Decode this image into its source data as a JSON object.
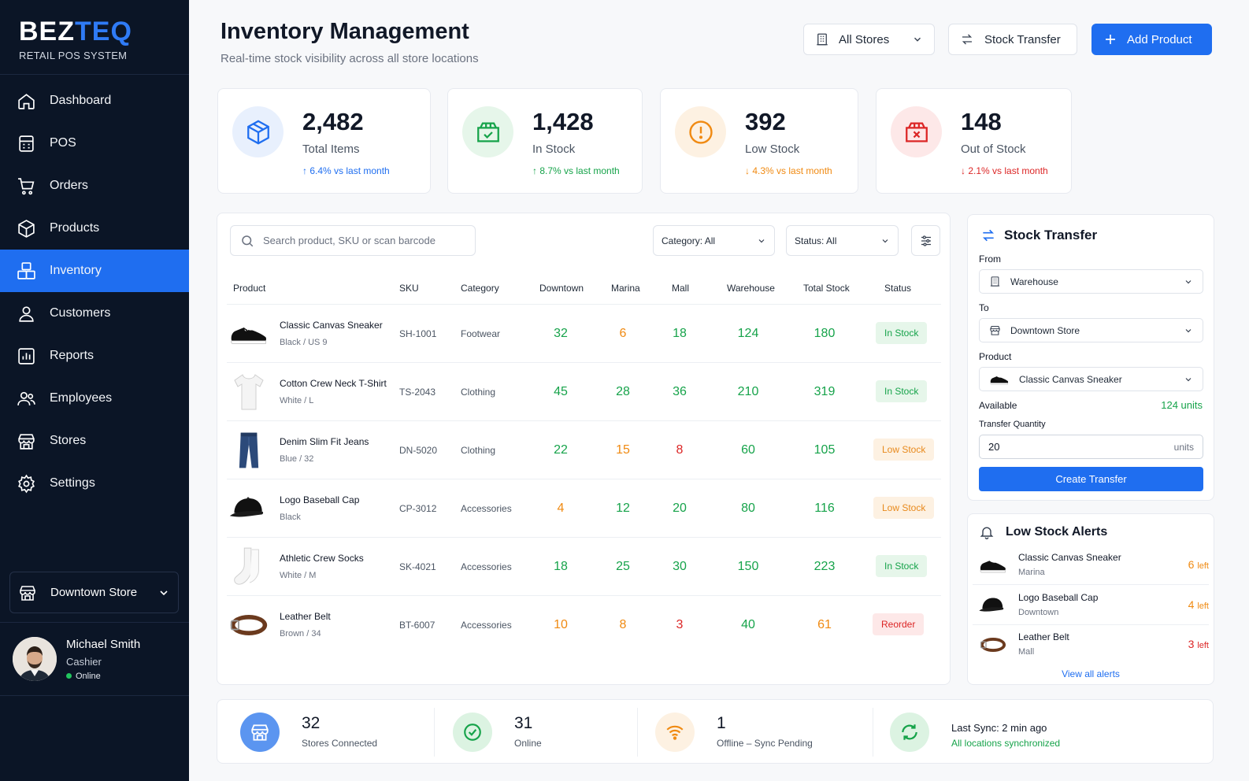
{
  "brand": {
    "name_a": "BEZ",
    "name_b": "TEQ",
    "subtitle": "RETAIL POS SYSTEM"
  },
  "sidebar": {
    "items": [
      {
        "label": "Dashboard",
        "icon": "home-icon"
      },
      {
        "label": "POS",
        "icon": "register-icon"
      },
      {
        "label": "Orders",
        "icon": "cart-icon"
      },
      {
        "label": "Products",
        "icon": "box-icon"
      },
      {
        "label": "Inventory",
        "icon": "boxes-icon",
        "active": true
      },
      {
        "label": "Customers",
        "icon": "user-icon"
      },
      {
        "label": "Reports",
        "icon": "chart-icon"
      },
      {
        "label": "Employees",
        "icon": "users-icon"
      },
      {
        "label": "Stores",
        "icon": "store-icon"
      },
      {
        "label": "Settings",
        "icon": "gear-icon"
      }
    ],
    "store": "Downtown Store",
    "user": {
      "name": "Michael Smith",
      "role": "Cashier",
      "status": "Online"
    }
  },
  "header": {
    "title": "Inventory Management",
    "subtitle": "Real-time stock visibility across all store locations",
    "stores_btn": "All Stores",
    "transfer_btn": "Stock Transfer",
    "add_btn": "Add Product"
  },
  "kpis": [
    {
      "value": "2,482",
      "label": "Total Items",
      "trend": "6.4% vs last month",
      "direction": "up",
      "color": "#1f6ef0"
    },
    {
      "value": "1,428",
      "label": "In Stock",
      "trend": "8.7% vs last month",
      "direction": "up",
      "color": "#16a34a"
    },
    {
      "value": "392",
      "label": "Low Stock",
      "trend": "4.3% vs last month",
      "direction": "down",
      "color": "#f08a12"
    },
    {
      "value": "148",
      "label": "Out of Stock",
      "trend": "2.1% vs last month",
      "direction": "down",
      "color": "#dc2626"
    }
  ],
  "table": {
    "search_placeholder": "Search product, SKU or scan barcode",
    "category_filter": "Category: All",
    "status_filter": "Status: All",
    "columns": [
      "Product",
      "SKU",
      "Category",
      "Downtown",
      "Marina",
      "Mall",
      "Warehouse",
      "Total Stock",
      "Status"
    ],
    "rows": [
      {
        "name": "Classic Canvas Sneaker",
        "variant": "Black / US 9",
        "sku": "SH-1001",
        "category": "Footwear",
        "downtown": "32",
        "marina": "6",
        "mall": "18",
        "warehouse": "124",
        "total": "180",
        "status": "In Stock",
        "image": "sneaker"
      },
      {
        "name": "Cotton Crew Neck T-Shirt",
        "variant": "White / L",
        "sku": "TS-2043",
        "category": "Clothing",
        "downtown": "45",
        "marina": "28",
        "mall": "36",
        "warehouse": "210",
        "total": "319",
        "status": "In Stock",
        "image": "tshirt"
      },
      {
        "name": "Denim Slim Fit Jeans",
        "variant": "Blue / 32",
        "sku": "DN-5020",
        "category": "Clothing",
        "downtown": "22",
        "marina": "15",
        "mall": "8",
        "warehouse": "60",
        "total": "105",
        "status": "Low Stock",
        "image": "jeans"
      },
      {
        "name": "Logo Baseball Cap",
        "variant": "Black",
        "sku": "CP-3012",
        "category": "Accessories",
        "downtown": "4",
        "marina": "12",
        "mall": "20",
        "warehouse": "80",
        "total": "116",
        "status": "Low Stock",
        "image": "cap"
      },
      {
        "name": "Athletic Crew Socks",
        "variant": "White / M",
        "sku": "SK-4021",
        "category": "Accessories",
        "downtown": "18",
        "marina": "25",
        "mall": "30",
        "warehouse": "150",
        "total": "223",
        "status": "In Stock",
        "image": "socks"
      },
      {
        "name": "Leather Belt",
        "variant": "Brown / 34",
        "sku": "BT-6007",
        "category": "Accessories",
        "downtown": "10",
        "marina": "8",
        "mall": "3",
        "warehouse": "40",
        "total": "61",
        "status": "Reorder",
        "image": "belt"
      }
    ]
  },
  "transfer": {
    "title": "Stock Transfer",
    "from_label": "From",
    "from_value": "Warehouse",
    "to_label": "To",
    "to_value": "Downtown Store",
    "product_label": "Product",
    "product_value": "Classic Canvas Sneaker",
    "available_label": "Available",
    "available_value": "124 units",
    "qty_label": "Transfer Quantity",
    "qty_value": "20",
    "qty_unit": "units",
    "button": "Create Transfer"
  },
  "alerts": {
    "title": "Low Stock Alerts",
    "items": [
      {
        "name": "Classic Canvas Sneaker",
        "location": "Marina",
        "count": "6",
        "suffix": "left",
        "image": "sneaker"
      },
      {
        "name": "Logo Baseball Cap",
        "location": "Downtown",
        "count": "4",
        "suffix": "left",
        "image": "cap"
      },
      {
        "name": "Leather Belt",
        "location": "Mall",
        "count": "3",
        "suffix": "left",
        "image": "belt"
      }
    ],
    "view_all": "View all alerts"
  },
  "status_bar": [
    {
      "big": "32",
      "small": "Stores Connected",
      "icon": "store-icon"
    },
    {
      "big": "31",
      "small": "Online",
      "icon": "check-icon"
    },
    {
      "big": "1",
      "small": "Offline – Sync Pending",
      "icon": "wifi-icon"
    },
    {
      "big": "Last Sync: 2 min ago",
      "small": "All locations synchronized",
      "icon": "sync-icon"
    }
  ]
}
